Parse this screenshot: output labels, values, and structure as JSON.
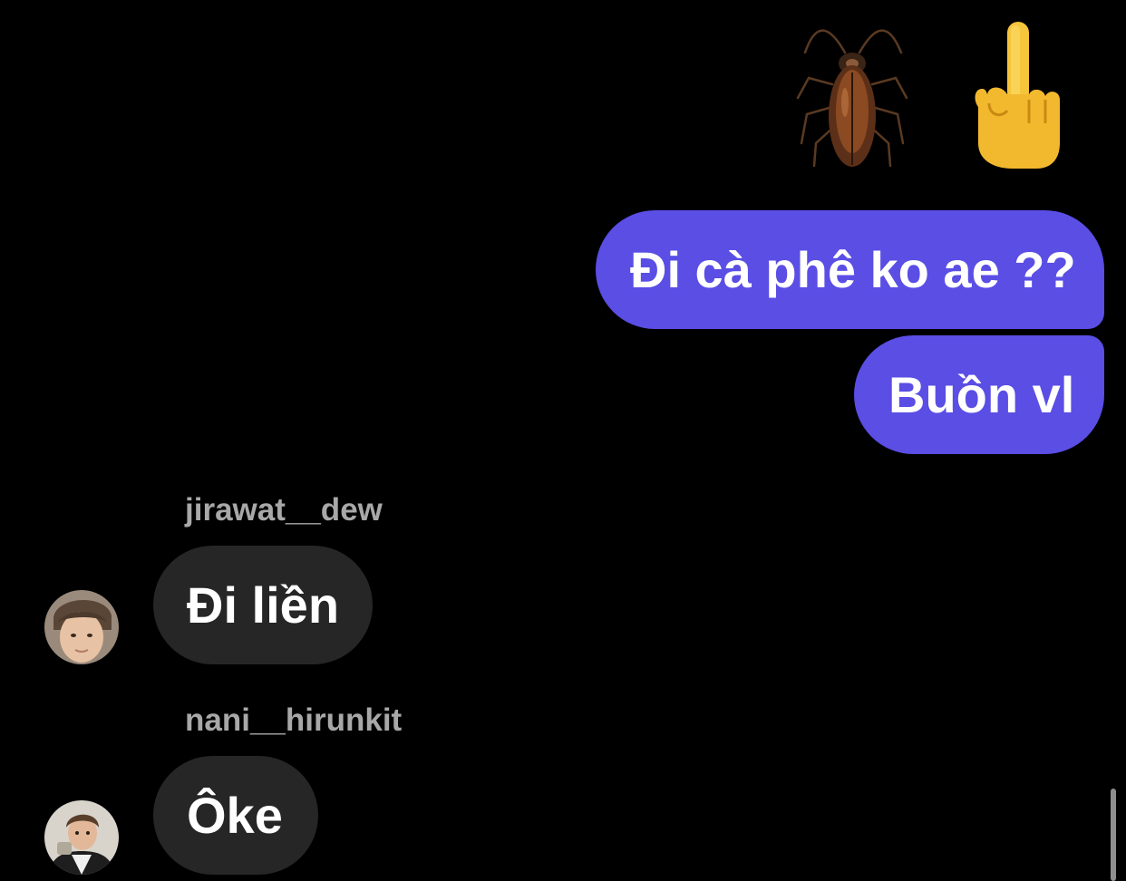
{
  "reactions": [
    {
      "icon": "cockroach-icon",
      "glyph": "🪳"
    },
    {
      "icon": "middle-finger-icon",
      "glyph": "🖕"
    }
  ],
  "messages": [
    {
      "direction": "outgoing",
      "text": "Đi cà phê ko ae ??"
    },
    {
      "direction": "outgoing",
      "text": "Buồn vl"
    },
    {
      "direction": "incoming",
      "sender": "jirawat__dew",
      "text": "Đi liền",
      "avatar": "avatar-jirawat"
    },
    {
      "direction": "incoming",
      "sender": "nani__hirunkit",
      "text": "Ôke",
      "avatar": "avatar-nani"
    }
  ],
  "colors": {
    "background": "#000000",
    "outgoing_bubble": "#5a4ee5",
    "incoming_bubble": "#262626",
    "sender_name": "#a8a8a8",
    "text": "#ffffff"
  }
}
